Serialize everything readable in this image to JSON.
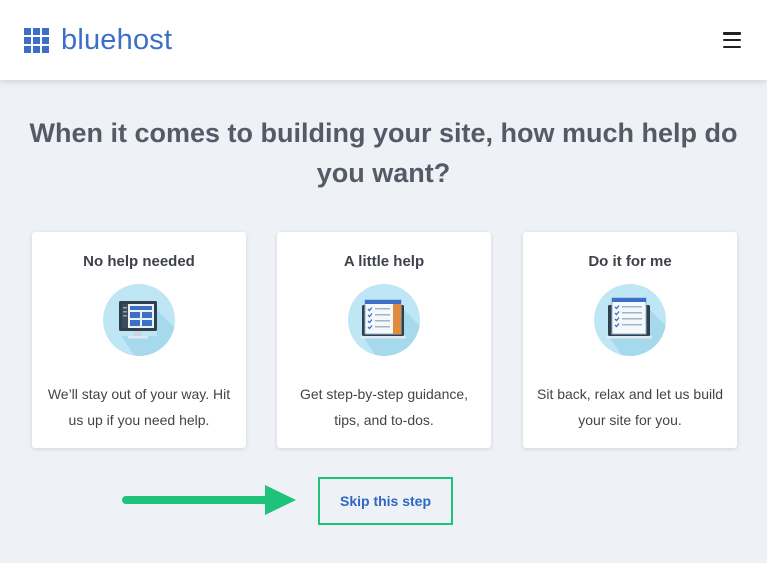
{
  "brand": {
    "name": "bluehost",
    "color": "#3d6fc7"
  },
  "header": {
    "menu_icon": "hamburger-icon"
  },
  "question": "When it comes to building your site, how much help do you want?",
  "cards": [
    {
      "title": "No help needed",
      "icon": "monitor-icon",
      "description": "We’ll stay out of your way. Hit us up if you need help."
    },
    {
      "title": "A little help",
      "icon": "checklist-icon",
      "description": "Get step-by-step guidance, tips, and to-dos."
    },
    {
      "title": "Do it for me",
      "icon": "clipboard-checklist-icon",
      "description": "Sit back, relax and let us build your site for you."
    }
  ],
  "skip": {
    "label": "Skip this step"
  },
  "colors": {
    "background": "#eef1f6",
    "accent": "#2e67c4",
    "highlight": "#1fc27a",
    "icon_circle": "#bfe6f4"
  }
}
